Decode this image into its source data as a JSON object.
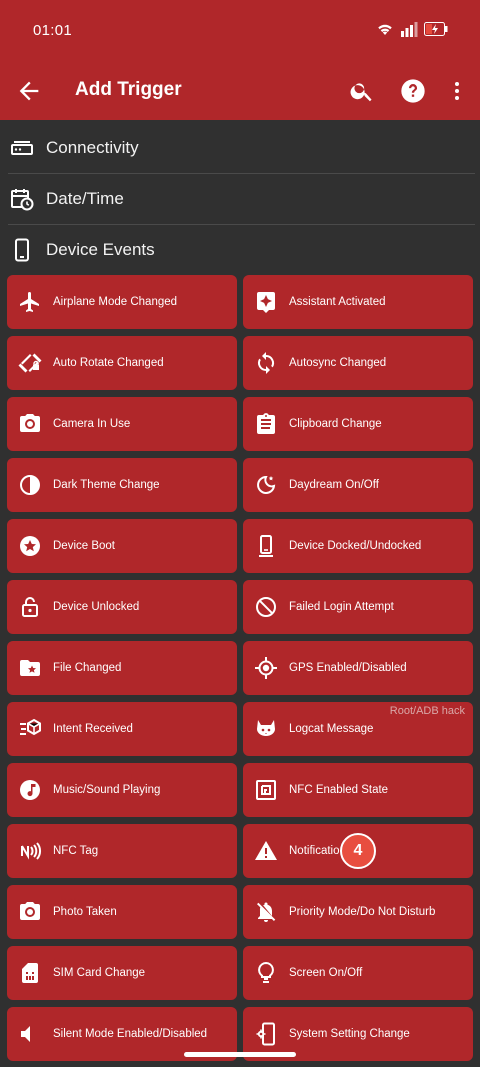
{
  "status": {
    "time": "01:01"
  },
  "toolbar": {
    "title": "Add Trigger"
  },
  "sections": [
    {
      "label": "Connectivity",
      "icon": "router-icon"
    },
    {
      "label": "Date/Time",
      "icon": "calendar-clock-icon"
    },
    {
      "label": "Device Events",
      "icon": "phone-icon"
    }
  ],
  "cards": [
    {
      "label": "Airplane Mode Changed",
      "icon": "airplane-icon"
    },
    {
      "label": "Assistant Activated",
      "icon": "assistant-icon"
    },
    {
      "label": "Auto Rotate Changed",
      "icon": "screen-rotation-lock-icon"
    },
    {
      "label": "Autosync Changed",
      "icon": "sync-icon"
    },
    {
      "label": "Camera In Use",
      "icon": "camera-icon"
    },
    {
      "label": "Clipboard Change",
      "icon": "clipboard-icon"
    },
    {
      "label": "Dark Theme Change",
      "icon": "contrast-icon"
    },
    {
      "label": "Daydream On/Off",
      "icon": "moon-stars-icon"
    },
    {
      "label": "Device Boot",
      "icon": "star-circle-icon"
    },
    {
      "label": "Device Docked/Undocked",
      "icon": "phone-docked-icon"
    },
    {
      "label": "Device Unlocked",
      "icon": "unlocked-icon"
    },
    {
      "label": "Failed Login Attempt",
      "icon": "block-icon"
    },
    {
      "label": "File Changed",
      "icon": "folder-star-icon"
    },
    {
      "label": "GPS Enabled/Disabled",
      "icon": "gps-icon"
    },
    {
      "label": "Intent Received",
      "icon": "intent-icon"
    },
    {
      "label": "Logcat Message",
      "icon": "cat-icon",
      "note": "Root/ADB hack"
    },
    {
      "label": "Music/Sound Playing",
      "icon": "music-note-icon"
    },
    {
      "label": "NFC Enabled State",
      "icon": "nfc-icon"
    },
    {
      "label": "NFC Tag",
      "icon": "nfc-tag-icon"
    },
    {
      "label": "Notificatio",
      "icon": "warning-icon"
    },
    {
      "label": "Photo Taken",
      "icon": "camera-photo-icon"
    },
    {
      "label": "Priority Mode/Do Not Disturb",
      "icon": "bell-off-icon"
    },
    {
      "label": "SIM Card Change",
      "icon": "sim-card-icon"
    },
    {
      "label": "Screen On/Off",
      "icon": "lightbulb-icon"
    },
    {
      "label": "Silent Mode Enabled/Disabled",
      "icon": "volume-mute-icon"
    },
    {
      "label": "System Setting Change",
      "icon": "settings-phone-icon"
    }
  ],
  "badge": {
    "value": "4"
  },
  "colors": {
    "accent": "#b0272a",
    "background": "#303030",
    "badge": "#e84e3f"
  }
}
